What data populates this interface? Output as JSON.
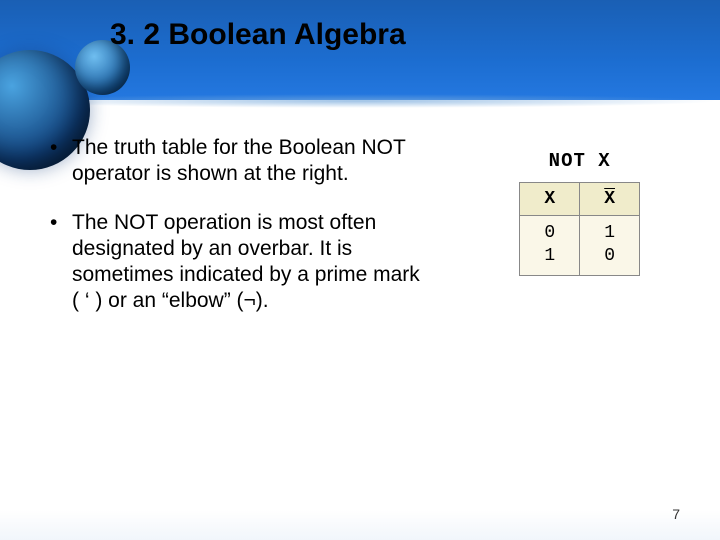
{
  "title": "3. 2 Boolean Algebra",
  "bullets": [
    "The truth table for the Boolean NOT operator is shown at the right.",
    "The NOT operation is most often designated by an overbar. It is sometimes indicated by a prime mark ( ‘ ) or an “elbow” (¬)."
  ],
  "table": {
    "caption_prefix": "NOT",
    "caption_var": "X",
    "header_x": "X",
    "header_xbar": "X",
    "col_x": [
      "0",
      "1"
    ],
    "col_xbar": [
      "1",
      "0"
    ]
  },
  "page_number": "7"
}
